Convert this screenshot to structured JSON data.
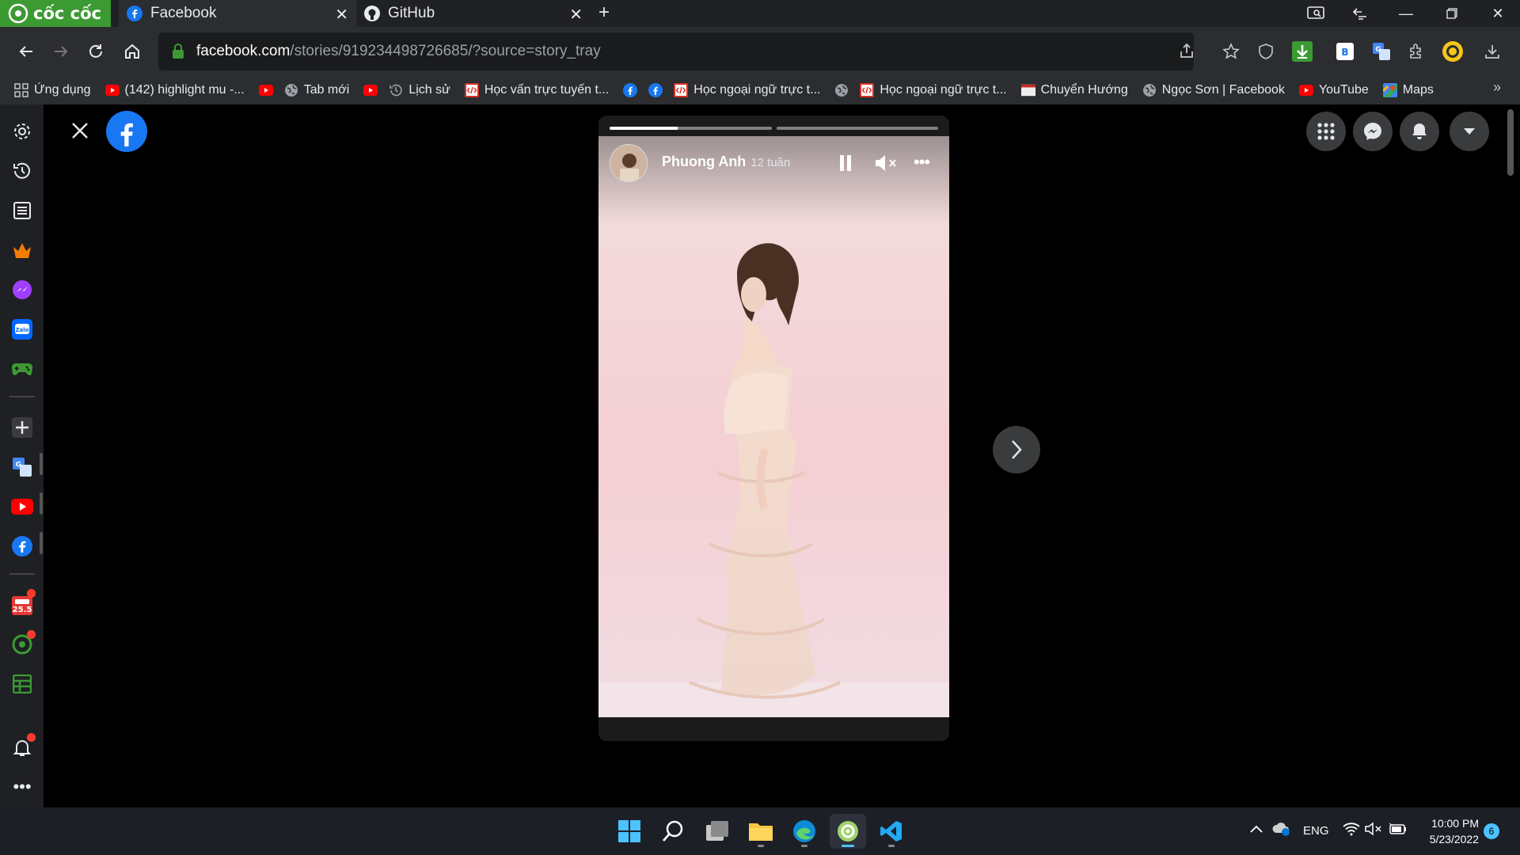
{
  "browser": {
    "brand": "cốc cốc",
    "tabs": [
      {
        "title": "Facebook"
      },
      {
        "title": "GitHub"
      }
    ],
    "url": {
      "host": "facebook.com",
      "path": "/stories/919234498726685/?source=story_tray"
    }
  },
  "bookmarks": [
    {
      "label": "Ứng dụng",
      "icon": "apps-grid-icon",
      "color": "#c4c7c5"
    },
    {
      "label": "(142) highlight mu -...",
      "icon": "youtube-icon",
      "color": "#ff0000"
    },
    {
      "label": "",
      "icon": "youtube-icon",
      "color": "#ff0000"
    },
    {
      "label": "Tab mới",
      "icon": "globe-icon",
      "color": "#9aa0a6"
    },
    {
      "label": "",
      "icon": "youtube-icon",
      "color": "#ff0000"
    },
    {
      "label": "Lịch sử",
      "icon": "history-icon",
      "color": "#9aa0a6"
    },
    {
      "label": "Học vấn trực tuyến t...",
      "icon": "code-site-icon",
      "color": "#d93025"
    },
    {
      "label": "",
      "icon": "facebook-icon",
      "color": "#1877f2"
    },
    {
      "label": "",
      "icon": "facebook-icon",
      "color": "#1877f2"
    },
    {
      "label": "Học ngoại ngữ trực t...",
      "icon": "code-site-icon",
      "color": "#d93025"
    },
    {
      "label": "",
      "icon": "globe-icon",
      "color": "#9aa0a6"
    },
    {
      "label": "Học ngoại ngữ trực t...",
      "icon": "code-site-icon",
      "color": "#d93025"
    },
    {
      "label": "Chuyển Hướng",
      "icon": "page-icon",
      "color": "#eeeeee"
    },
    {
      "label": "Ngọc Sơn | Facebook",
      "icon": "globe-icon",
      "color": "#9aa0a6"
    },
    {
      "label": "YouTube",
      "icon": "youtube-icon",
      "color": "#ff0000"
    },
    {
      "label": "Maps",
      "icon": "maps-icon",
      "color": "#34a853"
    }
  ],
  "story": {
    "author": "Phuong Anh",
    "time": "12 tuần",
    "progress_segments": [
      0.42,
      0
    ]
  },
  "taskbar": {
    "language": "ENG",
    "time": "10:00 PM",
    "date": "5/23/2022",
    "notification_count": "6"
  },
  "sidebar": {
    "calendar_badge": "25.5"
  },
  "colors": {
    "accent_green": "#3c9a33",
    "facebook_blue": "#1877f2"
  }
}
